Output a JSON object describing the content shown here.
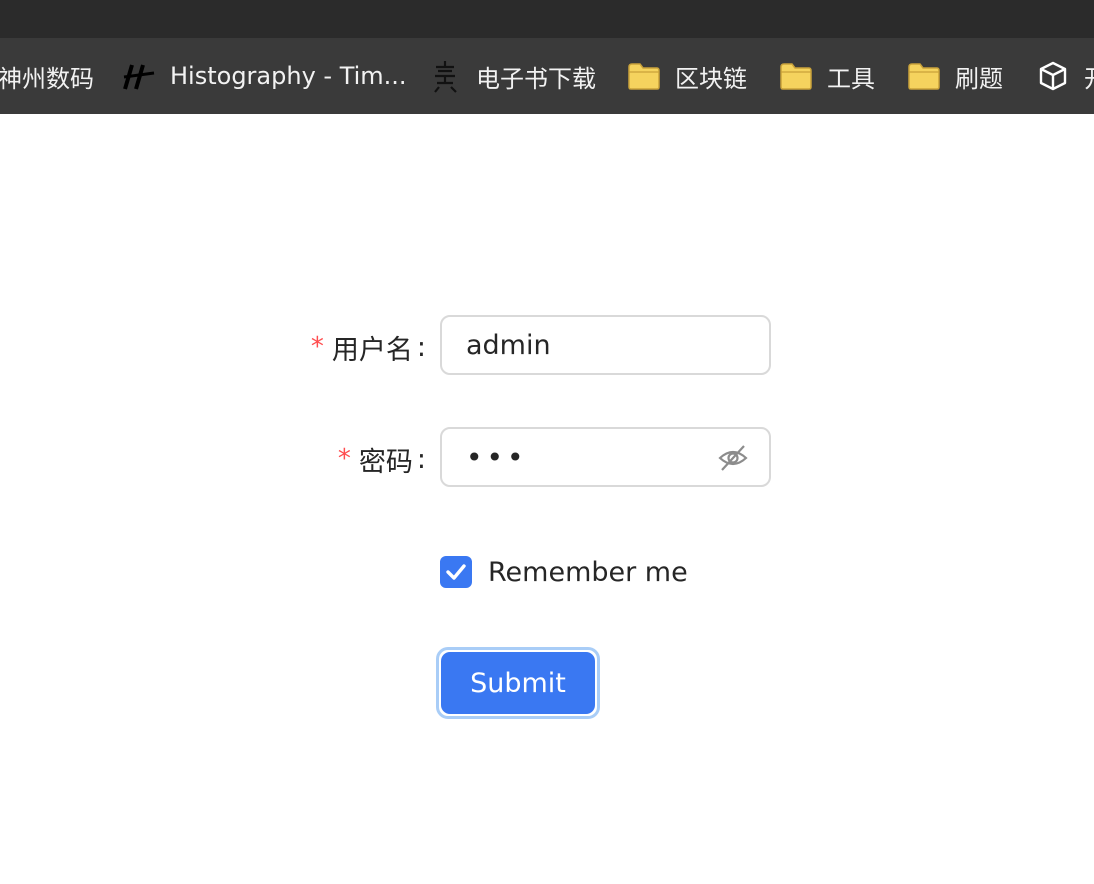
{
  "bookmarks": [
    {
      "label": "神州数码",
      "icon": "none"
    },
    {
      "label": "Histography - Tim...",
      "icon": "histography-logo-icon"
    },
    {
      "label": "电子书下载",
      "icon": "calligraphy-char-icon"
    },
    {
      "label": "区块链",
      "icon": "folder-icon"
    },
    {
      "label": "工具",
      "icon": "folder-icon"
    },
    {
      "label": "刷题",
      "icon": "folder-icon"
    },
    {
      "label": "开",
      "icon": "cube-icon"
    }
  ],
  "form": {
    "username": {
      "required_mark": "*",
      "label": "用户名",
      "colon": ":",
      "value": "admin"
    },
    "password": {
      "required_mark": "*",
      "label": "密码",
      "colon": ":",
      "value": "•••",
      "toggle_icon": "eye-invisible-icon"
    },
    "remember": {
      "label": "Remember me",
      "checked": true
    },
    "submit_label": "Submit"
  },
  "colors": {
    "primary": "#3a78f2",
    "required": "#ff4d4f",
    "bookmark_bar": "#3a3a3a",
    "folder": "#f5d35e"
  }
}
